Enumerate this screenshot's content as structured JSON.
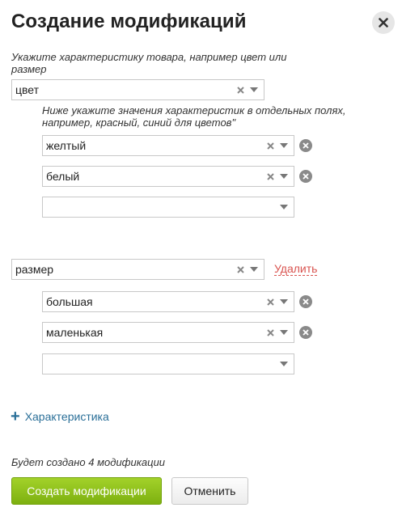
{
  "dialog": {
    "title": "Создание модификаций"
  },
  "property_hint": "Укажите характеристику товара, например цвет или размер",
  "values_hint": "Ниже укажите значения характеристик в отдельных полях, например, красный, синий для цветов\"",
  "characteristics": [
    {
      "name": "цвет",
      "values": [
        "желтый",
        "белый",
        ""
      ]
    },
    {
      "name": "размер",
      "delete_label": "Удалить",
      "values": [
        "большая",
        "маленькая",
        ""
      ]
    }
  ],
  "add_characteristic_label": "Характеристика",
  "summary": "Будет создано 4 модификации",
  "buttons": {
    "create": "Создать модификации",
    "cancel": "Отменить"
  },
  "colors": {
    "primary_green": "#8cc11a",
    "link_blue": "#2a6f98",
    "delete_red": "#d9534f"
  }
}
